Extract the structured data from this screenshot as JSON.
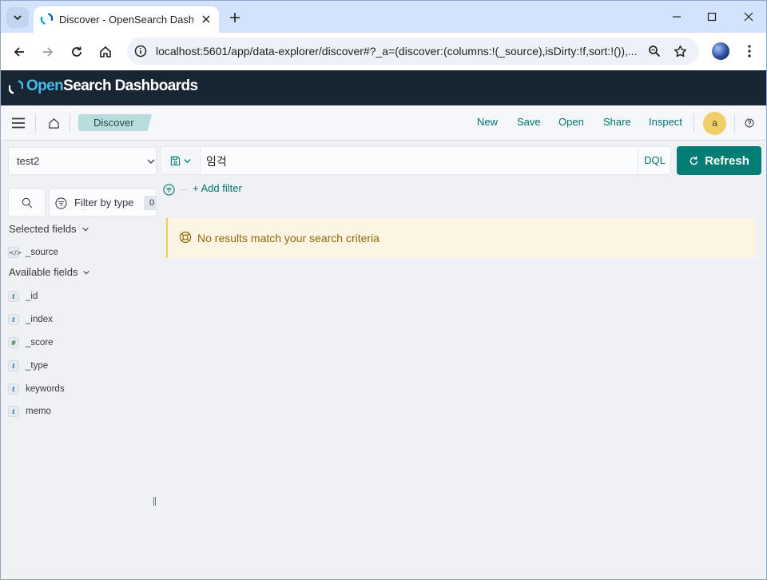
{
  "browser": {
    "tab_title": "Discover - OpenSearch Dashboards",
    "url": "localhost:5601/app/data-explorer/discover#?_a=(discover:(columns:!(_source),isDirty:!f,sort:!()),..."
  },
  "osd": {
    "logo_open": "Open",
    "logo_rest": "Search Dashboards"
  },
  "appbar": {
    "breadcrumb": "Discover",
    "menu": [
      "New",
      "Save",
      "Open",
      "Share",
      "Inspect"
    ],
    "avatar_initial": "a"
  },
  "query": {
    "index_pattern": "test2",
    "text": "임걱",
    "language": "DQL",
    "refresh_label": "Refresh",
    "add_filter_label": "+ Add filter"
  },
  "sidebar": {
    "filter_by_type_label": "Filter by type",
    "filter_by_type_count": "0",
    "selected_fields_label": "Selected fields",
    "selected_fields": [
      {
        "type": "source",
        "name": "_source"
      }
    ],
    "available_fields_label": "Available fields",
    "available_fields": [
      {
        "type": "t",
        "name": "_id"
      },
      {
        "type": "t",
        "name": "_index"
      },
      {
        "type": "#",
        "name": "_score"
      },
      {
        "type": "t",
        "name": "_type"
      },
      {
        "type": "t",
        "name": "keywords"
      },
      {
        "type": "t",
        "name": "memo"
      }
    ]
  },
  "results": {
    "empty_message": "No results match your search criteria"
  },
  "colors": {
    "accent": "#017d73",
    "header_bg": "#182633",
    "callout_bg": "#fdf5e4"
  }
}
